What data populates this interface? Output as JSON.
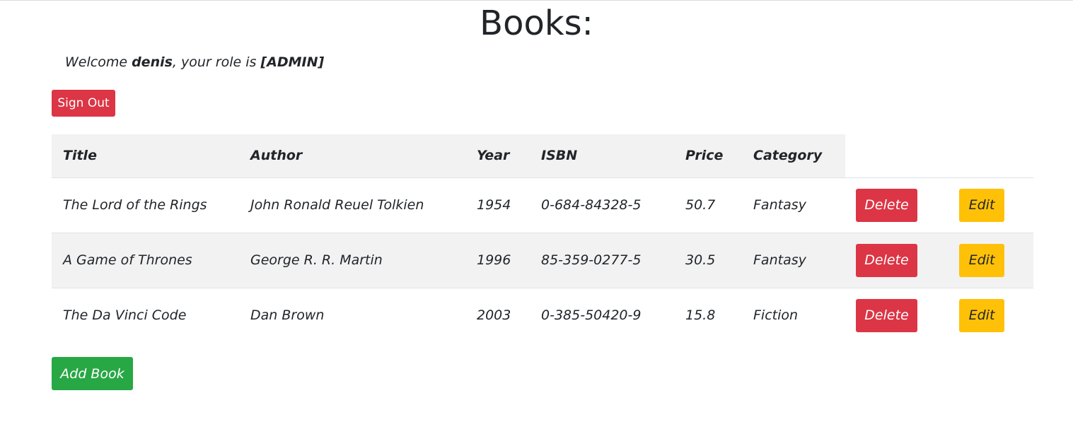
{
  "page": {
    "title": "Books:"
  },
  "welcome": {
    "prefix": "Welcome ",
    "username": "denis",
    "middle": ", your role is ",
    "role": "[ADMIN]"
  },
  "signout_label": "Sign Out",
  "table": {
    "headers": [
      "Title",
      "Author",
      "Year",
      "ISBN",
      "Price",
      "Category"
    ],
    "rows": [
      {
        "title": "The Lord of the Rings",
        "author": "John Ronald Reuel Tolkien",
        "year": "1954",
        "isbn": "0-684-84328-5",
        "price": "50.7",
        "category": "Fantasy"
      },
      {
        "title": "A Game of Thrones",
        "author": "George R. R. Martin",
        "year": "1996",
        "isbn": "85-359-0277-5",
        "price": "30.5",
        "category": "Fantasy"
      },
      {
        "title": "The Da Vinci Code",
        "author": "Dan Brown",
        "year": "2003",
        "isbn": "0-385-50420-9",
        "price": "15.8",
        "category": "Fiction"
      }
    ],
    "delete_label": "Delete",
    "edit_label": "Edit"
  },
  "add_book_label": "Add Book",
  "colors": {
    "danger": "#dc3545",
    "warning": "#ffc107",
    "success": "#28a745",
    "stripe": "#f2f2f2"
  }
}
